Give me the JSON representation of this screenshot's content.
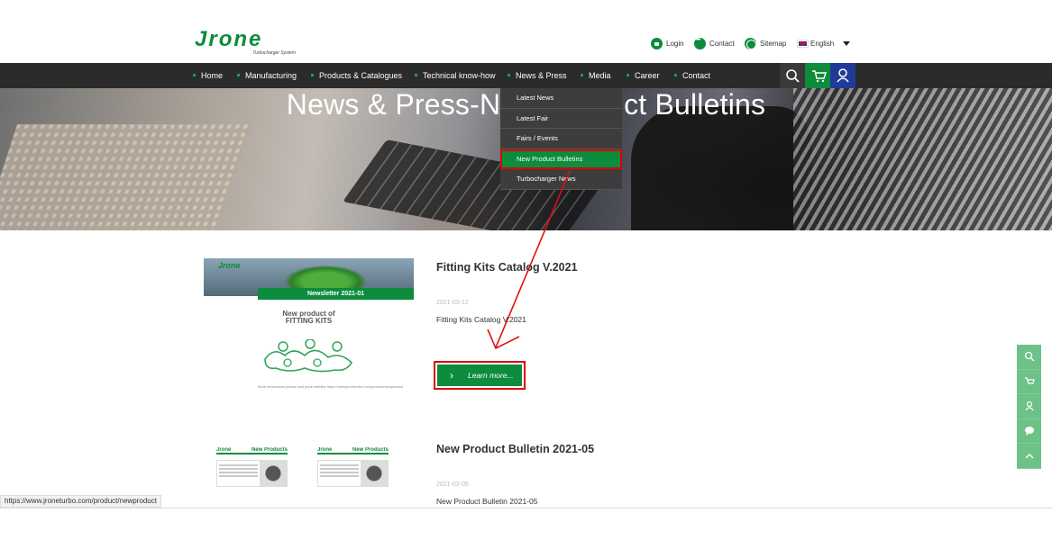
{
  "header": {
    "brand": "Jrone",
    "tagline": "Turbocharger System",
    "login": "Login",
    "contact": "Contact",
    "sitemap": "Sitemap",
    "language": "English"
  },
  "nav": {
    "items": [
      "Home",
      "Manufacturing",
      "Products & Catalogues",
      "Technical know-how",
      "News & Press",
      "Media",
      "Career",
      "Contact"
    ]
  },
  "hero": {
    "title": "News & Press-New Product Bulletins"
  },
  "dropdown": {
    "items": [
      "Latest News",
      "Latest Fair",
      "Fairs / Events",
      "New Product Bulletins",
      "Turbocharger News"
    ]
  },
  "posts": [
    {
      "title": "Fitting Kits Catalog V.2021",
      "date": "2021-03-12",
      "desc": "Fitting Kits Catalog V.2021",
      "thumb_band": "Newsletter 2021-01",
      "thumb_line1": "New product of",
      "thumb_line2": "FITTING KITS",
      "thumb_footer": "More information please visit jrone website https://www.jroneturbo.com/product/newproduct"
    },
    {
      "title": "New Product Bulletin 2021-05",
      "date": "2021-03-05",
      "desc": "New Product Bulletin 2021-05",
      "thumb_heading": "New Products"
    }
  ],
  "learn_more": "Learn more...",
  "status_url": "https://www.jroneturbo.com/product/newproduct",
  "colors": {
    "brand_green": "#0c8c3c",
    "nav_bg": "#2b2b2b",
    "highlight_red": "#dd0000",
    "user_blue": "#1f3a99"
  }
}
